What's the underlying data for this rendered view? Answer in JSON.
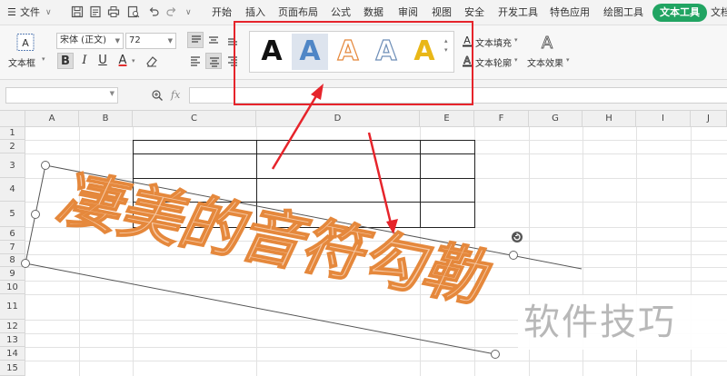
{
  "menu": {
    "file_label": "文件",
    "tabs": [
      "开始",
      "插入",
      "页面布局",
      "公式",
      "数据",
      "审阅",
      "视图",
      "安全",
      "开发工具",
      "特色应用",
      "绘图工具"
    ],
    "active_tab": "文本工具",
    "overflow_tab": "文档"
  },
  "ribbon": {
    "textbox_label": "文本框",
    "font_name": "宋体 (正文)",
    "font_size": "72",
    "bold": "B",
    "italic": "I",
    "underline": "U",
    "font_color": "A",
    "styles": [
      "A",
      "A",
      "A",
      "A",
      "A"
    ],
    "text_fill_label": "文本填充",
    "text_outline_label": "文本轮廓",
    "text_effects_label": "文本效果"
  },
  "formula_bar": {
    "fx": "fx",
    "value": ""
  },
  "grid": {
    "columns": [
      "A",
      "B",
      "C",
      "D",
      "E",
      "F",
      "G",
      "H",
      "I",
      "J"
    ],
    "rows": [
      "1",
      "2",
      "3",
      "4",
      "5",
      "6",
      "7",
      "8",
      "9",
      "10",
      "11",
      "12",
      "13",
      "14",
      "15"
    ]
  },
  "art_text": {
    "content": "凄美的音符勾勒"
  },
  "watermark": "软件技巧",
  "colors": {
    "accent_green": "#21a462",
    "highlight_red": "#e6242b",
    "art_fill": "#f6c8a4",
    "art_stroke": "#e5883c"
  }
}
